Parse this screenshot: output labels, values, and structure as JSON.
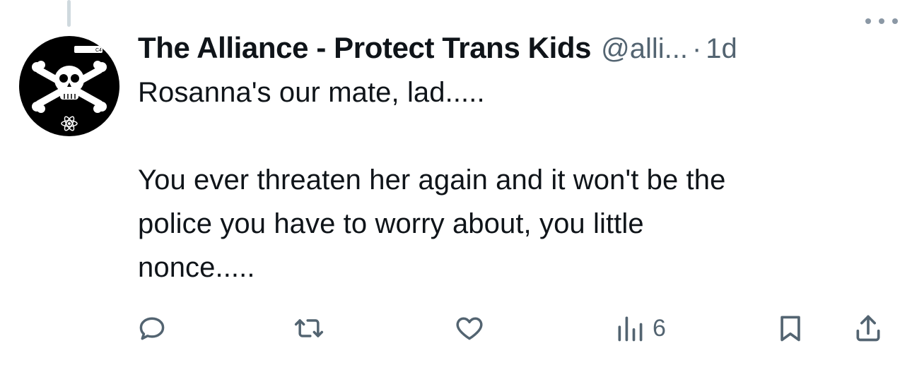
{
  "tweet": {
    "display_name": "The Alliance - Protect Trans Kids",
    "handle": "@alli...",
    "separator": "·",
    "timestamp": "1d",
    "text": "Rosanna's our mate, lad.....\n\nYou ever threaten her again and it won't be the\npolice you have to worry about, you little\nnonce....."
  },
  "avatar": {
    "icon": "skull-crossbones-icon",
    "badge_text": "C4"
  },
  "actions": {
    "reply_icon": "reply-icon",
    "repost_icon": "repost-icon",
    "like_icon": "heart-icon",
    "views_icon": "views-icon",
    "views_count": "6",
    "bookmark_icon": "bookmark-icon",
    "share_icon": "share-icon"
  },
  "colors": {
    "text": "#0f1419",
    "secondary": "#536471",
    "thread_line": "#cfd9de"
  }
}
